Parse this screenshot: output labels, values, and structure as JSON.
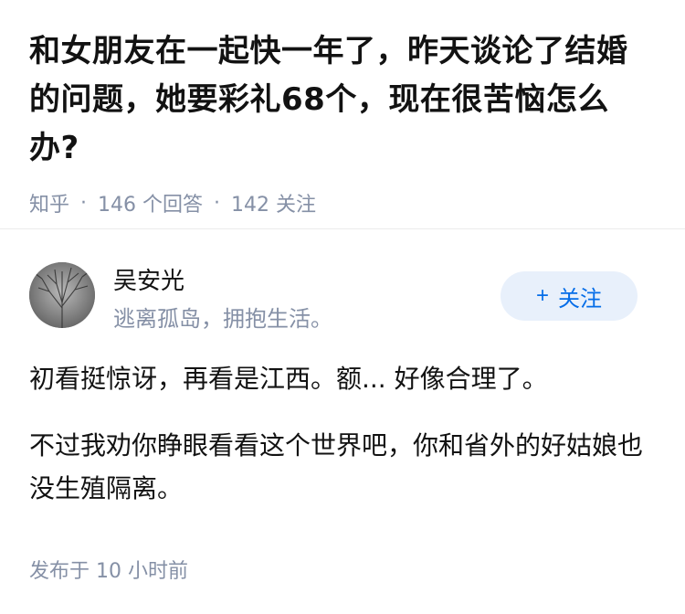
{
  "question": {
    "title": "和女朋友在一起快一年了，昨天谈论了结婚的问题，她要彩礼68个，现在很苦恼怎么办?",
    "source": "知乎",
    "answer_count": "146 个回答",
    "follow_count": "142 关注",
    "separator": "·"
  },
  "answer": {
    "author": {
      "name": "吴安光",
      "bio": "逃离孤岛，拥抱生活。",
      "avatar_icon": "tree-avatar"
    },
    "follow_button": {
      "plus": "+",
      "label": "关注"
    },
    "paragraphs": [
      "初看挺惊讶，再看是江西。额... 好像合理了。",
      "不过我劝你睁眼看看这个世界吧，你和省外的好姑娘也没生殖隔离。"
    ],
    "published": "发布于  10 小时前"
  },
  "colors": {
    "accent": "#056de8",
    "accent_bg": "#e8f0fb",
    "meta": "#8590a6",
    "text": "#121212"
  }
}
